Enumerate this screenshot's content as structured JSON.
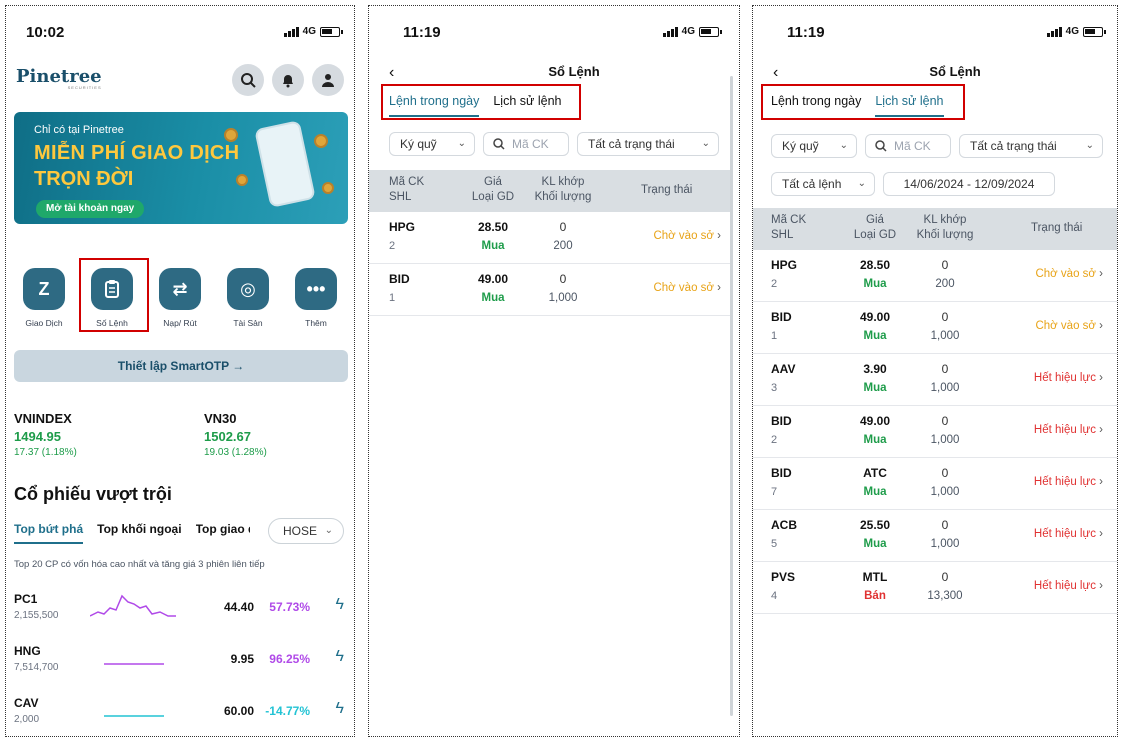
{
  "colors": {
    "accent": "#1f6f8b",
    "green": "#1e9c4a",
    "red": "#e03131",
    "pending": "#e8a317",
    "purple": "#b04ae8",
    "cyan": "#22c3d4",
    "highlight": "#d10000"
  },
  "home": {
    "time": "10:02",
    "network": "4G",
    "logo": "Pinetree",
    "logo_sub": "SECURITIES",
    "banner": {
      "small": "Chỉ có tại Pinetree",
      "title1": "MIỄN PHÍ GIAO DỊCH",
      "title2": "TRỌN ĐỜI",
      "cta": "Mở tài khoản ngay"
    },
    "quick": [
      {
        "label": "Giao Dịch",
        "icon": "trade-icon"
      },
      {
        "label": "Số Lệnh",
        "icon": "order-book-icon"
      },
      {
        "label": "Nạp/ Rút",
        "icon": "transfer-icon"
      },
      {
        "label": "Tài Sản",
        "icon": "asset-icon"
      },
      {
        "label": "Thêm",
        "icon": "more-icon"
      }
    ],
    "otp": "Thiết lập SmartOTP →",
    "indexes": [
      {
        "name": "VNINDEX",
        "value": "1494.95",
        "change": "17.37 (1.18%)"
      },
      {
        "name": "VN30",
        "value": "1502.67",
        "change": "19.03 (1.28%)"
      }
    ],
    "section_title": "Cổ phiếu vượt trội",
    "tabs": [
      "Top bứt phá",
      "Top khối ngoại",
      "Top giao d"
    ],
    "exchange": "HOSE",
    "subtitle": "Top 20 CP có vốn hóa cao nhất và tăng giá 3 phiên liên tiếp",
    "stocks": [
      {
        "symbol": "PC1",
        "volume": "2,155,500",
        "price": "44.40",
        "pct": "57.73%"
      },
      {
        "symbol": "HNG",
        "volume": "7,514,700",
        "price": "9.95",
        "pct": "96.25%"
      },
      {
        "symbol": "CAV",
        "volume": "2,000",
        "price": "60.00",
        "pct": "-14.77%"
      }
    ]
  },
  "today": {
    "time": "11:19",
    "network": "4G",
    "title": "Sổ Lệnh",
    "tab_today": "Lệnh trong ngày",
    "tab_history": "Lịch sử lệnh",
    "filter_account": "Ký quỹ",
    "search_placeholder": "Mã CK",
    "filter_status": "Tất cả trạng thái",
    "headers": {
      "c1a": "Mã CK",
      "c1b": "SHL",
      "c2a": "Giá",
      "c2b": "Loại GD",
      "c3a": "KL khớp",
      "c3b": "Khối lượng",
      "c4": "Trạng thái"
    },
    "rows": [
      {
        "sym": "HPG",
        "shl": "2",
        "price": "28.50",
        "side": "Mua",
        "matched": "0",
        "vol": "200",
        "status": "Chờ vào sở"
      },
      {
        "sym": "BID",
        "shl": "1",
        "price": "49.00",
        "side": "Mua",
        "matched": "0",
        "vol": "1,000",
        "status": "Chờ vào sở"
      }
    ]
  },
  "history": {
    "time": "11:19",
    "network": "4G",
    "title": "Sổ Lệnh",
    "tab_today": "Lệnh trong ngày",
    "tab_history": "Lịch sử lệnh",
    "filter_account": "Ký quỹ",
    "search_placeholder": "Mã CK",
    "filter_status": "Tất cả trạng thái",
    "filter_orders": "Tất cả lệnh",
    "date_range": "14/06/2024 - 12/09/2024",
    "headers": {
      "c1a": "Mã CK",
      "c1b": "SHL",
      "c2a": "Giá",
      "c2b": "Loại GD",
      "c3a": "KL khớp",
      "c3b": "Khối lượng",
      "c4": "Trạng thái"
    },
    "rows": [
      {
        "sym": "HPG",
        "shl": "2",
        "price": "28.50",
        "side": "Mua",
        "matched": "0",
        "vol": "200",
        "status": "Chờ vào sở"
      },
      {
        "sym": "BID",
        "shl": "1",
        "price": "49.00",
        "side": "Mua",
        "matched": "0",
        "vol": "1,000",
        "status": "Chờ vào sở"
      },
      {
        "sym": "AAV",
        "shl": "3",
        "price": "3.90",
        "side": "Mua",
        "matched": "0",
        "vol": "1,000",
        "status": "Hết hiệu lực"
      },
      {
        "sym": "BID",
        "shl": "2",
        "price": "49.00",
        "side": "Mua",
        "matched": "0",
        "vol": "1,000",
        "status": "Hết hiệu lực"
      },
      {
        "sym": "BID",
        "shl": "7",
        "price": "ATC",
        "side": "Mua",
        "matched": "0",
        "vol": "1,000",
        "status": "Hết hiệu lực"
      },
      {
        "sym": "ACB",
        "shl": "5",
        "price": "25.50",
        "side": "Mua",
        "matched": "0",
        "vol": "1,000",
        "status": "Hết hiệu lực"
      },
      {
        "sym": "PVS",
        "shl": "4",
        "price": "MTL",
        "side": "Bán",
        "matched": "0",
        "vol": "13,300",
        "status": "Hết hiệu lực"
      }
    ]
  }
}
